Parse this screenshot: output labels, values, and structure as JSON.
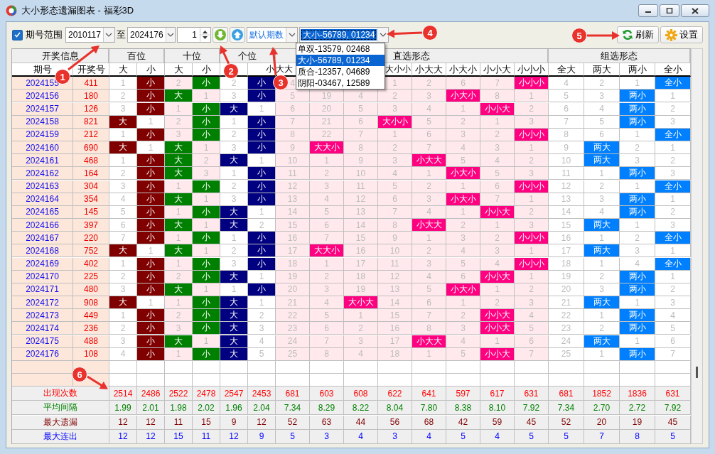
{
  "window": {
    "title": "大小形态遗漏图表 - 福彩3D"
  },
  "toolbar": {
    "range_checkbox": {
      "label": "期号范围",
      "checked": true
    },
    "from": "2010117",
    "to_label": "至",
    "to": "2024176",
    "step": "1",
    "period_mode": "默认期数",
    "pattern": "大小-56789, 01234",
    "buttons": [
      {
        "label": "刷新",
        "kind": "refresh"
      },
      {
        "label": "设置",
        "kind": "settings"
      }
    ]
  },
  "pattern_dropdown": {
    "options": [
      {
        "label": "单双-13579, 02468",
        "selected": false
      },
      {
        "label": "大小-56789, 01234",
        "selected": true
      },
      {
        "label": "质合-12357, 04689",
        "selected": false
      },
      {
        "label": "阴阳-03467, 12589",
        "selected": false
      }
    ]
  },
  "table": {
    "info_group": {
      "label": "开奖信息",
      "columns": [
        "期号",
        "开奖号"
      ]
    },
    "groups": [
      {
        "label": "百位",
        "color": "#800000",
        "columns": [
          "大",
          "小"
        ]
      },
      {
        "label": "十位",
        "color": "#008000",
        "columns": [
          "大",
          "小"
        ]
      },
      {
        "label": "个位",
        "color": "#000080",
        "columns": [
          null,
          "小"
        ]
      },
      {
        "label": "直选形态",
        "color": "#ff0080",
        "columns": [
          "大大",
          null,
          null,
          "大小小",
          "小大大",
          "小大小",
          "小小大",
          "小小小"
        ]
      },
      {
        "label": "组选形态",
        "color": "#0080ff",
        "columns": [
          "全大",
          "两大",
          "两小",
          "全小"
        ]
      }
    ],
    "rows": [
      {
        "issue": "2024155",
        "number": "411",
        "cells": [
          {
            "text": "1",
            "hit": false
          },
          {
            "text": "小",
            "hit": true
          },
          {
            "text": "2",
            "hit": false
          },
          {
            "text": "小",
            "hit": true
          },
          {
            "text": "2",
            "hit": false
          },
          {
            "text": "小",
            "hit": true
          },
          {
            "text": "4",
            "hit": false
          },
          null,
          null,
          {
            "text": "1",
            "hit": false
          },
          {
            "text": "2",
            "hit": false
          },
          {
            "text": "6",
            "hit": false
          },
          {
            "text": "7",
            "hit": false
          },
          {
            "text": "小小小",
            "hit": true
          },
          {
            "text": "4",
            "hit": false
          },
          {
            "text": "2",
            "hit": false
          },
          {
            "text": "1",
            "hit": false
          },
          {
            "text": "全小",
            "hit": true
          }
        ]
      },
      {
        "issue": "2024156",
        "number": "180",
        "cells": [
          {
            "text": "2",
            "hit": false
          },
          {
            "text": "小",
            "hit": true
          },
          {
            "text": "大",
            "hit": true
          },
          {
            "text": "1",
            "hit": false
          },
          {
            "text": "3",
            "hit": false
          },
          {
            "text": "小",
            "hit": true
          },
          {
            "text": "5",
            "hit": false
          },
          {
            "text": "19",
            "hit": false
          },
          {
            "text": "4",
            "hit": false
          },
          {
            "text": "2",
            "hit": false
          },
          {
            "text": "3",
            "hit": false
          },
          {
            "text": "小大小",
            "hit": true
          },
          {
            "text": "8",
            "hit": false
          },
          {
            "text": "1",
            "hit": false
          },
          {
            "text": "5",
            "hit": false
          },
          {
            "text": "3",
            "hit": false
          },
          {
            "text": "两小",
            "hit": true
          },
          {
            "text": "1",
            "hit": false
          }
        ]
      },
      {
        "issue": "2024157",
        "number": "126",
        "cells": [
          {
            "text": "3",
            "hit": false
          },
          {
            "text": "小",
            "hit": true
          },
          {
            "text": "1",
            "hit": false
          },
          {
            "text": "小",
            "hit": true
          },
          {
            "text": "大",
            "hit": true
          },
          {
            "text": "1",
            "hit": false
          },
          {
            "text": "6",
            "hit": false
          },
          {
            "text": "20",
            "hit": false
          },
          {
            "text": "5",
            "hit": false
          },
          {
            "text": "3",
            "hit": false
          },
          {
            "text": "4",
            "hit": false
          },
          {
            "text": "1",
            "hit": false
          },
          {
            "text": "小小大",
            "hit": true
          },
          {
            "text": "2",
            "hit": false
          },
          {
            "text": "6",
            "hit": false
          },
          {
            "text": "4",
            "hit": false
          },
          {
            "text": "两小",
            "hit": true
          },
          {
            "text": "2",
            "hit": false
          }
        ]
      },
      {
        "issue": "2024158",
        "number": "821",
        "cells": [
          {
            "text": "大",
            "hit": true
          },
          {
            "text": "1",
            "hit": false
          },
          {
            "text": "2",
            "hit": false
          },
          {
            "text": "小",
            "hit": true
          },
          {
            "text": "1",
            "hit": false
          },
          {
            "text": "小",
            "hit": true
          },
          {
            "text": "7",
            "hit": false
          },
          {
            "text": "21",
            "hit": false
          },
          {
            "text": "6",
            "hit": false
          },
          {
            "text": "大小小",
            "hit": true
          },
          {
            "text": "5",
            "hit": false
          },
          {
            "text": "2",
            "hit": false
          },
          {
            "text": "1",
            "hit": false
          },
          {
            "text": "3",
            "hit": false
          },
          {
            "text": "7",
            "hit": false
          },
          {
            "text": "5",
            "hit": false
          },
          {
            "text": "两小",
            "hit": true
          },
          {
            "text": "3",
            "hit": false
          }
        ]
      },
      {
        "issue": "2024159",
        "number": "212",
        "cells": [
          {
            "text": "1",
            "hit": false
          },
          {
            "text": "小",
            "hit": true
          },
          {
            "text": "3",
            "hit": false
          },
          {
            "text": "小",
            "hit": true
          },
          {
            "text": "2",
            "hit": false
          },
          {
            "text": "小",
            "hit": true
          },
          {
            "text": "8",
            "hit": false
          },
          {
            "text": "22",
            "hit": false
          },
          {
            "text": "7",
            "hit": false
          },
          {
            "text": "1",
            "hit": false
          },
          {
            "text": "6",
            "hit": false
          },
          {
            "text": "3",
            "hit": false
          },
          {
            "text": "2",
            "hit": false
          },
          {
            "text": "小小小",
            "hit": true
          },
          {
            "text": "8",
            "hit": false
          },
          {
            "text": "6",
            "hit": false
          },
          {
            "text": "1",
            "hit": false
          },
          {
            "text": "全小",
            "hit": true
          }
        ]
      },
      {
        "issue": "2024160",
        "number": "690",
        "cells": [
          {
            "text": "大",
            "hit": true
          },
          {
            "text": "1",
            "hit": false
          },
          {
            "text": "大",
            "hit": true
          },
          {
            "text": "1",
            "hit": false
          },
          {
            "text": "3",
            "hit": false
          },
          {
            "text": "小",
            "hit": true
          },
          {
            "text": "9",
            "hit": false
          },
          {
            "text": "大大小",
            "hit": true
          },
          {
            "text": "8",
            "hit": false
          },
          {
            "text": "2",
            "hit": false
          },
          {
            "text": "7",
            "hit": false
          },
          {
            "text": "4",
            "hit": false
          },
          {
            "text": "3",
            "hit": false
          },
          {
            "text": "1",
            "hit": false
          },
          {
            "text": "9",
            "hit": false
          },
          {
            "text": "两大",
            "hit": true
          },
          {
            "text": "2",
            "hit": false
          },
          {
            "text": "1",
            "hit": false
          }
        ]
      },
      {
        "issue": "2024161",
        "number": "468",
        "cells": [
          {
            "text": "1",
            "hit": false
          },
          {
            "text": "小",
            "hit": true
          },
          {
            "text": "大",
            "hit": true
          },
          {
            "text": "2",
            "hit": false
          },
          {
            "text": "大",
            "hit": true
          },
          {
            "text": "1",
            "hit": false
          },
          {
            "text": "10",
            "hit": false
          },
          {
            "text": "1",
            "hit": false
          },
          {
            "text": "9",
            "hit": false
          },
          {
            "text": "3",
            "hit": false
          },
          {
            "text": "小大大",
            "hit": true
          },
          {
            "text": "5",
            "hit": false
          },
          {
            "text": "4",
            "hit": false
          },
          {
            "text": "2",
            "hit": false
          },
          {
            "text": "10",
            "hit": false
          },
          {
            "text": "两大",
            "hit": true
          },
          {
            "text": "3",
            "hit": false
          },
          {
            "text": "2",
            "hit": false
          }
        ]
      },
      {
        "issue": "2024162",
        "number": "164",
        "cells": [
          {
            "text": "2",
            "hit": false
          },
          {
            "text": "小",
            "hit": true
          },
          {
            "text": "大",
            "hit": true
          },
          {
            "text": "3",
            "hit": false
          },
          {
            "text": "1",
            "hit": false
          },
          {
            "text": "小",
            "hit": true
          },
          {
            "text": "11",
            "hit": false
          },
          {
            "text": "2",
            "hit": false
          },
          {
            "text": "10",
            "hit": false
          },
          {
            "text": "4",
            "hit": false
          },
          {
            "text": "1",
            "hit": false
          },
          {
            "text": "小大小",
            "hit": true
          },
          {
            "text": "5",
            "hit": false
          },
          {
            "text": "3",
            "hit": false
          },
          {
            "text": "11",
            "hit": false
          },
          {
            "text": "1",
            "hit": false
          },
          {
            "text": "两小",
            "hit": true
          },
          {
            "text": "3",
            "hit": false
          }
        ]
      },
      {
        "issue": "2024163",
        "number": "304",
        "cells": [
          {
            "text": "3",
            "hit": false
          },
          {
            "text": "小",
            "hit": true
          },
          {
            "text": "1",
            "hit": false
          },
          {
            "text": "小",
            "hit": true
          },
          {
            "text": "2",
            "hit": false
          },
          {
            "text": "小",
            "hit": true
          },
          {
            "text": "12",
            "hit": false
          },
          {
            "text": "3",
            "hit": false
          },
          {
            "text": "11",
            "hit": false
          },
          {
            "text": "5",
            "hit": false
          },
          {
            "text": "2",
            "hit": false
          },
          {
            "text": "1",
            "hit": false
          },
          {
            "text": "6",
            "hit": false
          },
          {
            "text": "小小小",
            "hit": true
          },
          {
            "text": "12",
            "hit": false
          },
          {
            "text": "2",
            "hit": false
          },
          {
            "text": "1",
            "hit": false
          },
          {
            "text": "全小",
            "hit": true
          }
        ]
      },
      {
        "issue": "2024164",
        "number": "354",
        "cells": [
          {
            "text": "4",
            "hit": false
          },
          {
            "text": "小",
            "hit": true
          },
          {
            "text": "大",
            "hit": true
          },
          {
            "text": "1",
            "hit": false
          },
          {
            "text": "3",
            "hit": false
          },
          {
            "text": "小",
            "hit": true
          },
          {
            "text": "13",
            "hit": false
          },
          {
            "text": "4",
            "hit": false
          },
          {
            "text": "12",
            "hit": false
          },
          {
            "text": "6",
            "hit": false
          },
          {
            "text": "3",
            "hit": false
          },
          {
            "text": "小大小",
            "hit": true
          },
          {
            "text": "7",
            "hit": false
          },
          {
            "text": "1",
            "hit": false
          },
          {
            "text": "13",
            "hit": false
          },
          {
            "text": "3",
            "hit": false
          },
          {
            "text": "两小",
            "hit": true
          },
          {
            "text": "1",
            "hit": false
          }
        ]
      },
      {
        "issue": "2024165",
        "number": "145",
        "cells": [
          {
            "text": "5",
            "hit": false
          },
          {
            "text": "小",
            "hit": true
          },
          {
            "text": "1",
            "hit": false
          },
          {
            "text": "小",
            "hit": true
          },
          {
            "text": "大",
            "hit": true
          },
          {
            "text": "1",
            "hit": false
          },
          {
            "text": "14",
            "hit": false
          },
          {
            "text": "5",
            "hit": false
          },
          {
            "text": "13",
            "hit": false
          },
          {
            "text": "7",
            "hit": false
          },
          {
            "text": "4",
            "hit": false
          },
          {
            "text": "1",
            "hit": false
          },
          {
            "text": "小小大",
            "hit": true
          },
          {
            "text": "2",
            "hit": false
          },
          {
            "text": "14",
            "hit": false
          },
          {
            "text": "4",
            "hit": false
          },
          {
            "text": "两小",
            "hit": true
          },
          {
            "text": "2",
            "hit": false
          }
        ]
      },
      {
        "issue": "2024166",
        "number": "397",
        "cells": [
          {
            "text": "6",
            "hit": false
          },
          {
            "text": "小",
            "hit": true
          },
          {
            "text": "大",
            "hit": true
          },
          {
            "text": "1",
            "hit": false
          },
          {
            "text": "大",
            "hit": true
          },
          {
            "text": "2",
            "hit": false
          },
          {
            "text": "15",
            "hit": false
          },
          {
            "text": "6",
            "hit": false
          },
          {
            "text": "14",
            "hit": false
          },
          {
            "text": "8",
            "hit": false
          },
          {
            "text": "小大大",
            "hit": true
          },
          {
            "text": "2",
            "hit": false
          },
          {
            "text": "1",
            "hit": false
          },
          {
            "text": "3",
            "hit": false
          },
          {
            "text": "15",
            "hit": false
          },
          {
            "text": "两大",
            "hit": true
          },
          {
            "text": "1",
            "hit": false
          },
          {
            "text": "3",
            "hit": false
          }
        ]
      },
      {
        "issue": "2024167",
        "number": "220",
        "cells": [
          {
            "text": "7",
            "hit": false
          },
          {
            "text": "小",
            "hit": true
          },
          {
            "text": "1",
            "hit": false
          },
          {
            "text": "小",
            "hit": true
          },
          {
            "text": "1",
            "hit": false
          },
          {
            "text": "小",
            "hit": true
          },
          {
            "text": "16",
            "hit": false
          },
          {
            "text": "7",
            "hit": false
          },
          {
            "text": "15",
            "hit": false
          },
          {
            "text": "9",
            "hit": false
          },
          {
            "text": "1",
            "hit": false
          },
          {
            "text": "3",
            "hit": false
          },
          {
            "text": "2",
            "hit": false
          },
          {
            "text": "小小小",
            "hit": true
          },
          {
            "text": "16",
            "hit": false
          },
          {
            "text": "1",
            "hit": false
          },
          {
            "text": "2",
            "hit": false
          },
          {
            "text": "全小",
            "hit": true
          }
        ]
      },
      {
        "issue": "2024168",
        "number": "752",
        "cells": [
          {
            "text": "大",
            "hit": true
          },
          {
            "text": "1",
            "hit": false
          },
          {
            "text": "大",
            "hit": true
          },
          {
            "text": "1",
            "hit": false
          },
          {
            "text": "2",
            "hit": false
          },
          {
            "text": "小",
            "hit": true
          },
          {
            "text": "17",
            "hit": false
          },
          {
            "text": "大大小",
            "hit": true
          },
          {
            "text": "16",
            "hit": false
          },
          {
            "text": "10",
            "hit": false
          },
          {
            "text": "2",
            "hit": false
          },
          {
            "text": "4",
            "hit": false
          },
          {
            "text": "3",
            "hit": false
          },
          {
            "text": "1",
            "hit": false
          },
          {
            "text": "17",
            "hit": false
          },
          {
            "text": "两大",
            "hit": true
          },
          {
            "text": "3",
            "hit": false
          },
          {
            "text": "1",
            "hit": false
          }
        ]
      },
      {
        "issue": "2024169",
        "number": "402",
        "cells": [
          {
            "text": "1",
            "hit": false
          },
          {
            "text": "小",
            "hit": true
          },
          {
            "text": "1",
            "hit": false
          },
          {
            "text": "小",
            "hit": true
          },
          {
            "text": "3",
            "hit": false
          },
          {
            "text": "小",
            "hit": true
          },
          {
            "text": "18",
            "hit": false
          },
          {
            "text": "1",
            "hit": false
          },
          {
            "text": "17",
            "hit": false
          },
          {
            "text": "11",
            "hit": false
          },
          {
            "text": "3",
            "hit": false
          },
          {
            "text": "5",
            "hit": false
          },
          {
            "text": "4",
            "hit": false
          },
          {
            "text": "小小小",
            "hit": true
          },
          {
            "text": "18",
            "hit": false
          },
          {
            "text": "1",
            "hit": false
          },
          {
            "text": "4",
            "hit": false
          },
          {
            "text": "全小",
            "hit": true
          }
        ]
      },
      {
        "issue": "2024170",
        "number": "225",
        "cells": [
          {
            "text": "2",
            "hit": false
          },
          {
            "text": "小",
            "hit": true
          },
          {
            "text": "2",
            "hit": false
          },
          {
            "text": "小",
            "hit": true
          },
          {
            "text": "大",
            "hit": true
          },
          {
            "text": "1",
            "hit": false
          },
          {
            "text": "19",
            "hit": false
          },
          {
            "text": "2",
            "hit": false
          },
          {
            "text": "18",
            "hit": false
          },
          {
            "text": "12",
            "hit": false
          },
          {
            "text": "4",
            "hit": false
          },
          {
            "text": "6",
            "hit": false
          },
          {
            "text": "小小大",
            "hit": true
          },
          {
            "text": "1",
            "hit": false
          },
          {
            "text": "19",
            "hit": false
          },
          {
            "text": "2",
            "hit": false
          },
          {
            "text": "两小",
            "hit": true
          },
          {
            "text": "1",
            "hit": false
          }
        ]
      },
      {
        "issue": "2024171",
        "number": "480",
        "cells": [
          {
            "text": "3",
            "hit": false
          },
          {
            "text": "小",
            "hit": true
          },
          {
            "text": "大",
            "hit": true
          },
          {
            "text": "1",
            "hit": false
          },
          {
            "text": "1",
            "hit": false
          },
          {
            "text": "小",
            "hit": true
          },
          {
            "text": "20",
            "hit": false
          },
          {
            "text": "3",
            "hit": false
          },
          {
            "text": "19",
            "hit": false
          },
          {
            "text": "13",
            "hit": false
          },
          {
            "text": "5",
            "hit": false
          },
          {
            "text": "小大小",
            "hit": true
          },
          {
            "text": "1",
            "hit": false
          },
          {
            "text": "2",
            "hit": false
          },
          {
            "text": "20",
            "hit": false
          },
          {
            "text": "3",
            "hit": false
          },
          {
            "text": "两小",
            "hit": true
          },
          {
            "text": "2",
            "hit": false
          }
        ]
      },
      {
        "issue": "2024172",
        "number": "908",
        "cells": [
          {
            "text": "大",
            "hit": true
          },
          {
            "text": "1",
            "hit": false
          },
          {
            "text": "1",
            "hit": false
          },
          {
            "text": "小",
            "hit": true
          },
          {
            "text": "大",
            "hit": true
          },
          {
            "text": "1",
            "hit": false
          },
          {
            "text": "21",
            "hit": false
          },
          {
            "text": "4",
            "hit": false
          },
          {
            "text": "大小大",
            "hit": true
          },
          {
            "text": "14",
            "hit": false
          },
          {
            "text": "6",
            "hit": false
          },
          {
            "text": "1",
            "hit": false
          },
          {
            "text": "2",
            "hit": false
          },
          {
            "text": "3",
            "hit": false
          },
          {
            "text": "21",
            "hit": false
          },
          {
            "text": "两大",
            "hit": true
          },
          {
            "text": "1",
            "hit": false
          },
          {
            "text": "3",
            "hit": false
          }
        ]
      },
      {
        "issue": "2024173",
        "number": "449",
        "cells": [
          {
            "text": "1",
            "hit": false
          },
          {
            "text": "小",
            "hit": true
          },
          {
            "text": "2",
            "hit": false
          },
          {
            "text": "小",
            "hit": true
          },
          {
            "text": "大",
            "hit": true
          },
          {
            "text": "2",
            "hit": false
          },
          {
            "text": "22",
            "hit": false
          },
          {
            "text": "5",
            "hit": false
          },
          {
            "text": "1",
            "hit": false
          },
          {
            "text": "15",
            "hit": false
          },
          {
            "text": "7",
            "hit": false
          },
          {
            "text": "2",
            "hit": false
          },
          {
            "text": "小小大",
            "hit": true
          },
          {
            "text": "4",
            "hit": false
          },
          {
            "text": "22",
            "hit": false
          },
          {
            "text": "1",
            "hit": false
          },
          {
            "text": "两小",
            "hit": true
          },
          {
            "text": "4",
            "hit": false
          }
        ]
      },
      {
        "issue": "2024174",
        "number": "236",
        "cells": [
          {
            "text": "2",
            "hit": false
          },
          {
            "text": "小",
            "hit": true
          },
          {
            "text": "3",
            "hit": false
          },
          {
            "text": "小",
            "hit": true
          },
          {
            "text": "大",
            "hit": true
          },
          {
            "text": "3",
            "hit": false
          },
          {
            "text": "23",
            "hit": false
          },
          {
            "text": "6",
            "hit": false
          },
          {
            "text": "2",
            "hit": false
          },
          {
            "text": "16",
            "hit": false
          },
          {
            "text": "8",
            "hit": false
          },
          {
            "text": "3",
            "hit": false
          },
          {
            "text": "小小大",
            "hit": true
          },
          {
            "text": "5",
            "hit": false
          },
          {
            "text": "23",
            "hit": false
          },
          {
            "text": "2",
            "hit": false
          },
          {
            "text": "两小",
            "hit": true
          },
          {
            "text": "5",
            "hit": false
          }
        ]
      },
      {
        "issue": "2024175",
        "number": "488",
        "cells": [
          {
            "text": "3",
            "hit": false
          },
          {
            "text": "小",
            "hit": true
          },
          {
            "text": "大",
            "hit": true
          },
          {
            "text": "1",
            "hit": false
          },
          {
            "text": "大",
            "hit": true
          },
          {
            "text": "4",
            "hit": false
          },
          {
            "text": "24",
            "hit": false
          },
          {
            "text": "7",
            "hit": false
          },
          {
            "text": "3",
            "hit": false
          },
          {
            "text": "17",
            "hit": false
          },
          {
            "text": "小大大",
            "hit": true
          },
          {
            "text": "4",
            "hit": false
          },
          {
            "text": "1",
            "hit": false
          },
          {
            "text": "6",
            "hit": false
          },
          {
            "text": "24",
            "hit": false
          },
          {
            "text": "两大",
            "hit": true
          },
          {
            "text": "1",
            "hit": false
          },
          {
            "text": "6",
            "hit": false
          }
        ]
      },
      {
        "issue": "2024176",
        "number": "108",
        "cells": [
          {
            "text": "4",
            "hit": false
          },
          {
            "text": "小",
            "hit": true
          },
          {
            "text": "1",
            "hit": false
          },
          {
            "text": "小",
            "hit": true
          },
          {
            "text": "大",
            "hit": true
          },
          {
            "text": "5",
            "hit": false
          },
          {
            "text": "25",
            "hit": false
          },
          {
            "text": "8",
            "hit": false
          },
          {
            "text": "4",
            "hit": false
          },
          {
            "text": "18",
            "hit": false
          },
          {
            "text": "1",
            "hit": false
          },
          {
            "text": "5",
            "hit": false
          },
          {
            "text": "小小大",
            "hit": true
          },
          {
            "text": "7",
            "hit": false
          },
          {
            "text": "25",
            "hit": false
          },
          {
            "text": "1",
            "hit": false
          },
          {
            "text": "两小",
            "hit": true
          },
          {
            "text": "7",
            "hit": false
          }
        ]
      }
    ],
    "summary": [
      {
        "label": "出现次数",
        "kind": "count",
        "values": [
          "2514",
          "2486",
          "2522",
          "2478",
          "2547",
          "2453",
          "681",
          "603",
          "608",
          "622",
          "641",
          "597",
          "617",
          "631",
          "681",
          "1852",
          "1836",
          "631"
        ]
      },
      {
        "label": "平均间隔",
        "kind": "average",
        "values": [
          "1.99",
          "2.01",
          "1.98",
          "2.02",
          "1.96",
          "2.04",
          "7.34",
          "8.29",
          "8.22",
          "8.04",
          "7.80",
          "8.38",
          "8.10",
          "7.92",
          "7.34",
          "2.70",
          "2.72",
          "7.92"
        ]
      },
      {
        "label": "最大遗漏",
        "kind": "max_missing",
        "values": [
          "12",
          "12",
          "11",
          "15",
          "9",
          "12",
          "52",
          "63",
          "44",
          "56",
          "68",
          "42",
          "59",
          "45",
          "52",
          "20",
          "19",
          "45"
        ]
      },
      {
        "label": "最大连出",
        "kind": "max_streak",
        "values": [
          "12",
          "12",
          "15",
          "11",
          "12",
          "9",
          "5",
          "3",
          "4",
          "3",
          "4",
          "5",
          "4",
          "5",
          "5",
          "7",
          "8",
          "5"
        ]
      }
    ]
  },
  "callouts": [
    {
      "number": "1"
    },
    {
      "number": "2"
    },
    {
      "number": "3"
    },
    {
      "number": "4"
    },
    {
      "number": "5"
    },
    {
      "number": "6"
    }
  ]
}
